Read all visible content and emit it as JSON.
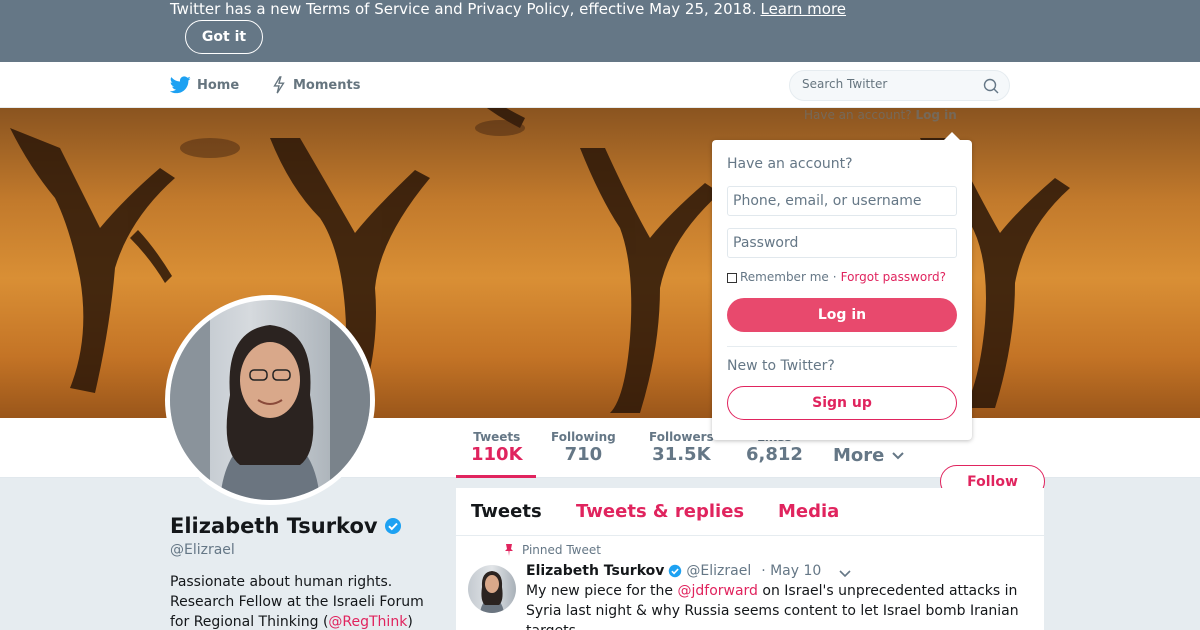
{
  "banner": {
    "text": "Twitter has a new Terms of Service and Privacy Policy, effective May 25, 2018.",
    "link": "Learn more",
    "button": "Got it"
  },
  "nav": {
    "home": "Home",
    "moments": "Moments",
    "search_placeholder": "Search Twitter",
    "have_account": "Have an account?",
    "login_link": "Log in"
  },
  "login": {
    "title": "Have an account?",
    "username_placeholder": "Phone, email, or username",
    "password_placeholder": "Password",
    "remember": "Remember me",
    "separator": "·",
    "forgot": "Forgot password?",
    "login_button": "Log in",
    "new_to": "New to Twitter?",
    "signup_button": "Sign up"
  },
  "stats": [
    {
      "label": "Tweets",
      "value": "110K"
    },
    {
      "label": "Following",
      "value": "710"
    },
    {
      "label": "Followers",
      "value": "31.5K"
    },
    {
      "label": "Likes",
      "value": "6,812"
    }
  ],
  "more_label": "More",
  "follow_label": "Follow",
  "profile": {
    "name": "Elizabeth Tsurkov",
    "handle": "@Elizrael",
    "bio_text": "Passionate about human rights. Research Fellow at the Israeli Forum for Regional Thinking (",
    "bio_link": "@RegThink",
    "bio_end": ")"
  },
  "tabs": [
    "Tweets",
    "Tweets & replies",
    "Media"
  ],
  "tweet": {
    "pinned_label": "Pinned Tweet",
    "name": "Elizabeth Tsurkov",
    "handle": "@Elizrael",
    "date": "· May 10",
    "text_before": "My new piece for the ",
    "mention": "@jdforward",
    "text_after": " on Israel's unprecedented attacks in Syria last night & why Russia seems content to let Israel bomb Iranian targets"
  },
  "colors": {
    "accent": "#e0245e",
    "banner_bg": "#657786",
    "verified": "#1da1f2",
    "twitter_blue": "#1da1f2"
  }
}
